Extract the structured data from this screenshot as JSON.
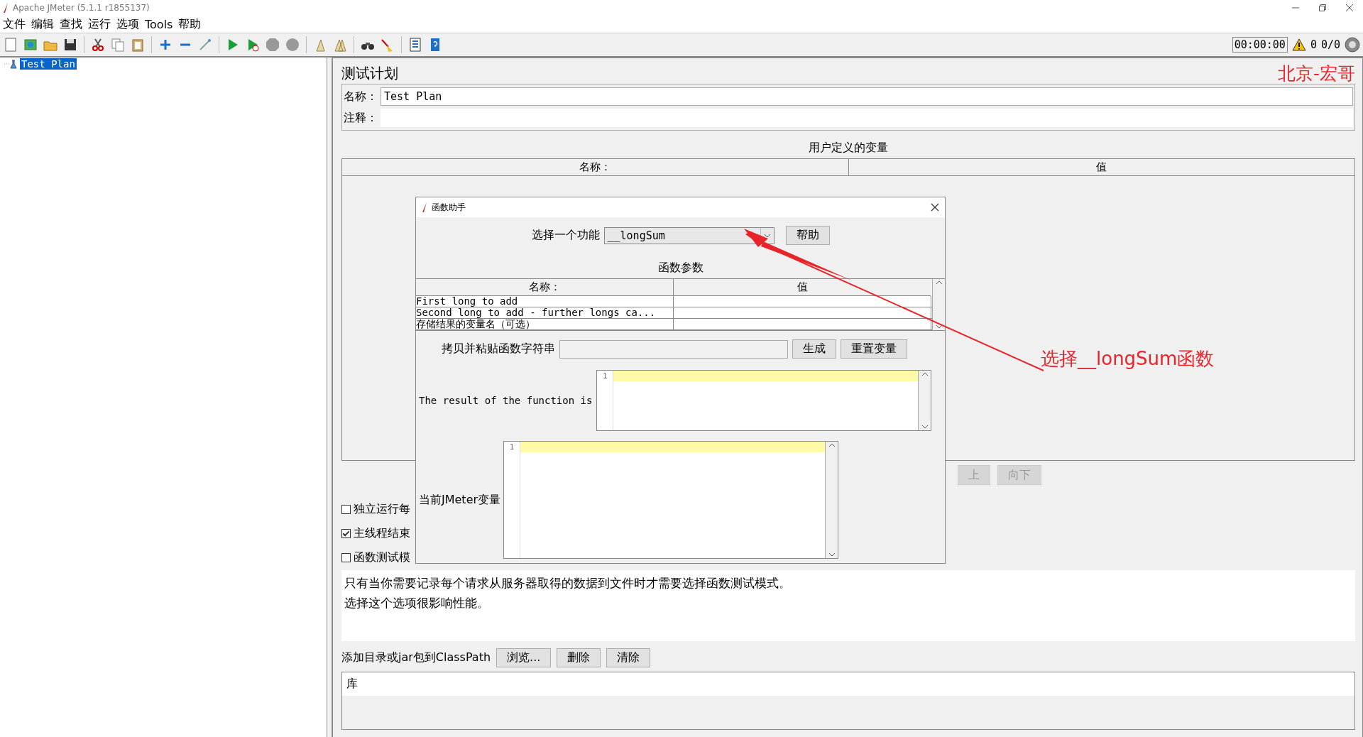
{
  "window": {
    "title": "Apache JMeter (5.1.1 r1855137)"
  },
  "menu": [
    "文件",
    "编辑",
    "查找",
    "运行",
    "选项",
    "Tools",
    "帮助"
  ],
  "status": {
    "timer": "00:00:00",
    "warnings": "0",
    "threads": "0/0"
  },
  "tree": [
    {
      "label": "Test Plan",
      "selected": true
    }
  ],
  "panel": {
    "title": "测试计划",
    "name_label": "名称：",
    "name_value": "Test Plan",
    "comment_label": "注释：",
    "variables": {
      "title": "用户定义的变量",
      "columns": [
        "名称：",
        "值"
      ]
    },
    "buttons": [
      {
        "label": "上",
        "disabled": true
      },
      {
        "label": "向下",
        "disabled": true
      }
    ],
    "options": [
      {
        "label": "独立运行每",
        "checked": false
      },
      {
        "label": "主线程结束",
        "checked": true
      },
      {
        "label": "函数测试模",
        "checked": false
      }
    ],
    "note": [
      "只有当你需要记录每个请求从服务器取得的数据到文件时才需要选择函数测试模式。",
      "选择这个选项很影响性能。"
    ],
    "classpath": {
      "label": "添加目录或jar包到ClassPath",
      "buttons": [
        "浏览...",
        "删除",
        "清除"
      ],
      "column": "库"
    }
  },
  "dialog": {
    "title": "函数助手",
    "select_label": "选择一个功能",
    "function": "__longSum",
    "help_button": "帮助",
    "params_title": "函数参数",
    "columns": [
      "名称：",
      "值"
    ],
    "params": [
      {
        "name": "First long to add"
      },
      {
        "name": "Second long to add - further longs ca..."
      },
      {
        "name": "存储结果的变量名（可选）"
      }
    ],
    "copy_label": "拷贝并粘贴函数字符串",
    "generate_button": "生成",
    "reset_button": "重置变量",
    "result_label": "The result of the function is",
    "result_line": "1",
    "vars_label": "当前JMeter变量",
    "vars_line": "1"
  },
  "annotations": {
    "watermark": "北京-宏哥",
    "callout": "选择__longSum函数"
  }
}
